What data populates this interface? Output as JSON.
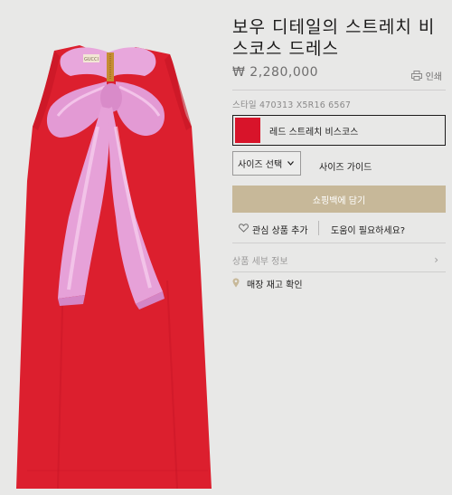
{
  "product": {
    "title": "보우 디테일의 스트레치 비스코스 드레스",
    "price": "₩ 2,280,000",
    "print_label": "인쇄",
    "style_number": "스타일 470313 X5R16 6567",
    "color": {
      "label": "레드 스트레치 비스코스",
      "swatch": "#d8142a"
    },
    "size_select": {
      "selected": "사이즈 선택",
      "icon": "chevron-down-icon"
    },
    "size_guide": "사이즈 가이드",
    "add_to_bag": "쇼핑백에 담기",
    "wishlist_label": "관심 상품 추가",
    "help_label": "도움이 필요하세요?",
    "details_label": "상품 세부 정보",
    "store_check_label": "매장 재고 확인"
  },
  "image": {
    "neck_label": "GUCCI"
  },
  "colors": {
    "background": "#e8e8e7",
    "dress_red": "#dc1f2e",
    "bow_pink": "#e6a1d8",
    "cta_gold": "#c7b899"
  }
}
